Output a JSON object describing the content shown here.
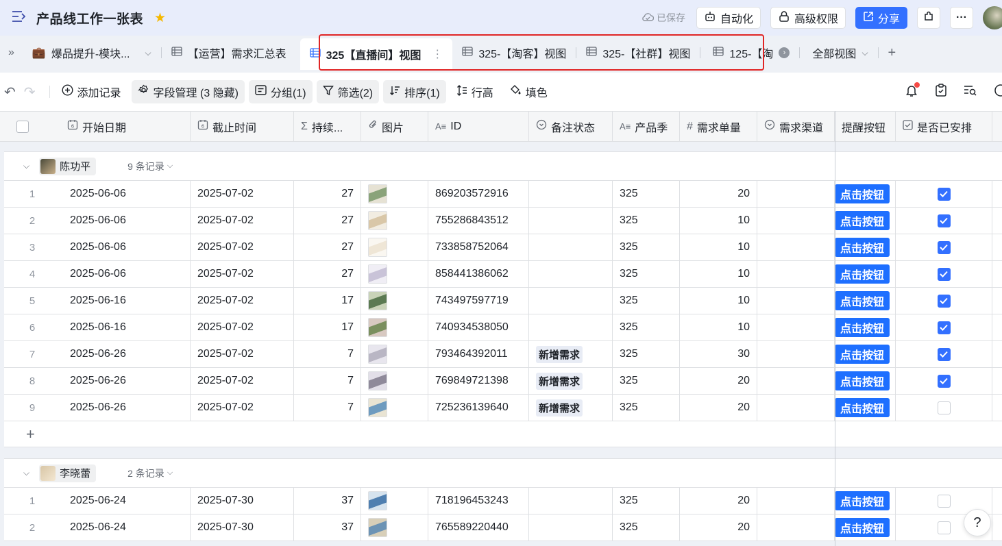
{
  "header": {
    "title": "产品线工作一张表",
    "saved": "已保存",
    "automation": "自动化",
    "advanced_perm": "高级权限",
    "share": "分享"
  },
  "tabs": [
    {
      "label": "爆品提升-模块...",
      "type": "folder"
    },
    {
      "label": "【运营】需求汇总表",
      "type": "grid"
    },
    {
      "label": "325【直播间】视图",
      "type": "grid",
      "active": true
    },
    {
      "label": "325-【淘客】视图",
      "type": "grid"
    },
    {
      "label": "325-【社群】视图",
      "type": "grid"
    },
    {
      "label": "125-【淘",
      "type": "grid"
    },
    {
      "label": "全部视图",
      "type": "dropdown"
    }
  ],
  "toolbar": {
    "add_record": "添加记录",
    "field_mgmt": "字段管理 (3 隐藏)",
    "group": "分组(1)",
    "filter": "筛选(2)",
    "sort": "排序(1)",
    "row_height": "行高",
    "fill": "填色"
  },
  "columns": [
    "开始日期",
    "截止时间",
    "持续...",
    "图片",
    "ID",
    "备注状态",
    "产品季",
    "需求单量",
    "需求渠道",
    "提醒按钮",
    "是否已安排"
  ],
  "button_label": "点击按钮",
  "groups": [
    {
      "name": "陈功平",
      "count": "9 条记录",
      "rows": [
        {
          "i": "1",
          "start": "2025-06-06",
          "end": "2025-07-02",
          "dur": "27",
          "id": "869203572916",
          "status": "",
          "season": "325",
          "qty": "20",
          "checked": true
        },
        {
          "i": "2",
          "start": "2025-06-06",
          "end": "2025-07-02",
          "dur": "27",
          "id": "755286843512",
          "status": "",
          "season": "325",
          "qty": "10",
          "checked": true
        },
        {
          "i": "3",
          "start": "2025-06-06",
          "end": "2025-07-02",
          "dur": "27",
          "id": "733858752064",
          "status": "",
          "season": "325",
          "qty": "10",
          "checked": true
        },
        {
          "i": "4",
          "start": "2025-06-06",
          "end": "2025-07-02",
          "dur": "27",
          "id": "858441386062",
          "status": "",
          "season": "325",
          "qty": "10",
          "checked": true
        },
        {
          "i": "5",
          "start": "2025-06-16",
          "end": "2025-07-02",
          "dur": "17",
          "id": "743497597719",
          "status": "",
          "season": "325",
          "qty": "10",
          "checked": true
        },
        {
          "i": "6",
          "start": "2025-06-16",
          "end": "2025-07-02",
          "dur": "17",
          "id": "740934538050",
          "status": "",
          "season": "325",
          "qty": "10",
          "checked": true
        },
        {
          "i": "7",
          "start": "2025-06-26",
          "end": "2025-07-02",
          "dur": "7",
          "id": "793464392011",
          "status": "新增需求",
          "season": "325",
          "qty": "30",
          "checked": true
        },
        {
          "i": "8",
          "start": "2025-06-26",
          "end": "2025-07-02",
          "dur": "7",
          "id": "769849721398",
          "status": "新增需求",
          "season": "325",
          "qty": "20",
          "checked": true
        },
        {
          "i": "9",
          "start": "2025-06-26",
          "end": "2025-07-02",
          "dur": "7",
          "id": "725236139640",
          "status": "新增需求",
          "season": "325",
          "qty": "20",
          "checked": false
        }
      ]
    },
    {
      "name": "李晓蕾",
      "count": "2 条记录",
      "rows": [
        {
          "i": "1",
          "start": "2025-06-24",
          "end": "2025-07-30",
          "dur": "37",
          "id": "718196453243",
          "status": "",
          "season": "325",
          "qty": "20",
          "checked": false
        },
        {
          "i": "2",
          "start": "2025-06-24",
          "end": "2025-07-30",
          "dur": "37",
          "id": "765589220440",
          "status": "",
          "season": "325",
          "qty": "20",
          "checked": false
        }
      ]
    }
  ]
}
